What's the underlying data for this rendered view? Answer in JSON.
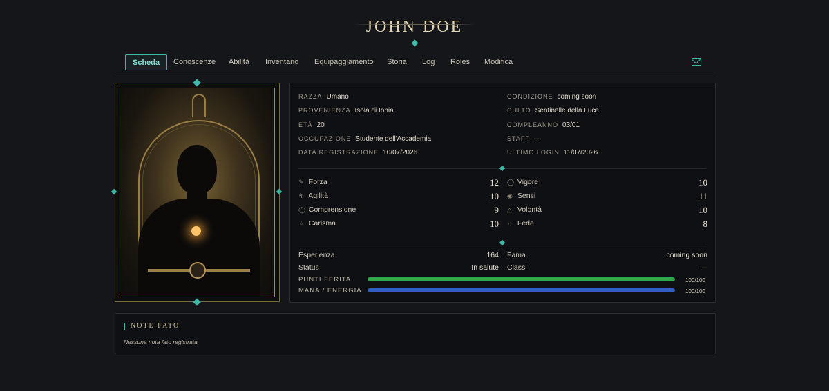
{
  "title": "JOHN DOE",
  "nav": {
    "items": [
      "Scheda",
      "Conoscenze",
      "Abilità",
      "Inventario",
      "Equipaggiamento",
      "Storia",
      "Log",
      "Roles",
      "Modifica"
    ],
    "active": "Scheda"
  },
  "profile": {
    "left": [
      {
        "label": "RAZZA",
        "value": "Umano"
      },
      {
        "label": "PROVENIENZA",
        "value": "Isola di Ionia"
      },
      {
        "label": "ETÀ",
        "value": "20"
      },
      {
        "label": "OCCUPAZIONE",
        "value": "Studente dell'Accademia"
      },
      {
        "label": "DATA REGISTRAZIONE",
        "value": "10/07/2026"
      }
    ],
    "right": [
      {
        "label": "CONDIZIONE",
        "value": "coming soon"
      },
      {
        "label": "CULTO",
        "value": "Sentinelle della Luce"
      },
      {
        "label": "COMPLEANNO",
        "value": "03/01"
      },
      {
        "label": "STAFF",
        "value": "—"
      },
      {
        "label": "ULTIMO LOGIN",
        "value": "11/07/2026"
      }
    ]
  },
  "stats": {
    "left": [
      {
        "label": "Forza",
        "value": "12",
        "icon": "sword-icon"
      },
      {
        "label": "Agilità",
        "value": "10",
        "icon": "lightning-icon"
      },
      {
        "label": "Comprensione",
        "value": "9",
        "icon": "bulb-icon"
      },
      {
        "label": "Carisma",
        "value": "10",
        "icon": "star-icon"
      }
    ],
    "right": [
      {
        "label": "Vigore",
        "value": "10",
        "icon": "shield-icon"
      },
      {
        "label": "Sensi",
        "value": "11",
        "icon": "eye-icon"
      },
      {
        "label": "Volontà",
        "value": "10",
        "icon": "flame-icon"
      },
      {
        "label": "Fede",
        "value": "8",
        "icon": "sun-icon"
      }
    ]
  },
  "progress": {
    "esperienza_label": "Esperienza",
    "esperienza_value": "164",
    "fama_label": "Fama",
    "fama_value": "coming soon",
    "status_label": "Status",
    "status_value": "In salute",
    "classi_label": "Classi",
    "classi_value": "—",
    "hp_label": "PUNTI FERITA",
    "hp_value": "100/100",
    "hp_fraction": 1.0,
    "hp_color": "#2fa84a",
    "mana_label": "MANA / ENERGIA",
    "mana_value": "100/100",
    "mana_fraction": 1.0,
    "mana_color": "#2f5fc4"
  },
  "notes": {
    "title": "NOTE FATO",
    "empty": "Nessuna nota fato registrata."
  },
  "colors": {
    "accent": "#3fb7a6",
    "gold": "#e6d7b3"
  }
}
